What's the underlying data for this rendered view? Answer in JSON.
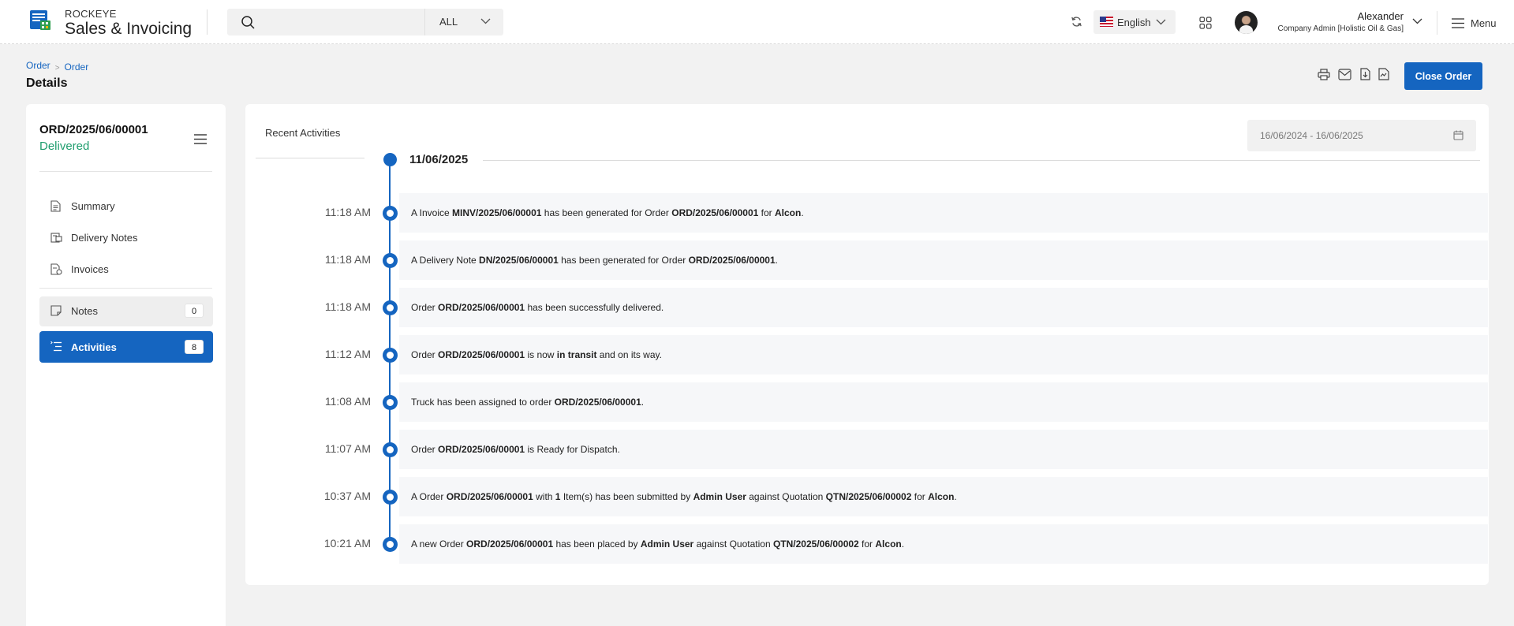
{
  "header": {
    "brand_small": "ROCKEYE",
    "brand_big": "Sales & Invoicing",
    "search_placeholder": "",
    "scope": "ALL",
    "language": "English",
    "user_name": "Alexander",
    "user_role": "Company Admin [Holistic Oil & Gas]",
    "menu_label": "Menu"
  },
  "breadcrumb": {
    "root": "Order",
    "current": "Order",
    "separator": ">"
  },
  "page": {
    "title": "Details",
    "close_order": "Close Order"
  },
  "order": {
    "id": "ORD/2025/06/00001",
    "status": "Delivered"
  },
  "sidebar": {
    "items": [
      {
        "label": "Summary",
        "icon": "document-icon"
      },
      {
        "label": "Delivery Notes",
        "icon": "delivery-note-icon"
      },
      {
        "label": "Invoices",
        "icon": "invoice-icon"
      }
    ],
    "notes": {
      "label": "Notes",
      "count": "0"
    },
    "activities": {
      "label": "Activities",
      "count": "8"
    }
  },
  "activities": {
    "title": "Recent Activities",
    "date_range": "16/06/2024 - 16/06/2025",
    "date": "11/06/2025",
    "entries": [
      {
        "time": "11:18 AM",
        "parts": [
          [
            "A Invoice ",
            false
          ],
          [
            "MINV/2025/06/00001",
            true
          ],
          [
            " has been generated for Order ",
            false
          ],
          [
            "ORD/2025/06/00001",
            true
          ],
          [
            " for ",
            false
          ],
          [
            "Alcon",
            true
          ],
          [
            ".",
            false
          ]
        ]
      },
      {
        "time": "11:18 AM",
        "parts": [
          [
            "A Delivery Note ",
            false
          ],
          [
            "DN/2025/06/00001",
            true
          ],
          [
            " has been generated for Order ",
            false
          ],
          [
            "ORD/2025/06/00001",
            true
          ],
          [
            ".",
            false
          ]
        ]
      },
      {
        "time": "11:18 AM",
        "parts": [
          [
            "Order ",
            false
          ],
          [
            "ORD/2025/06/00001",
            true
          ],
          [
            " has been successfully delivered.",
            false
          ]
        ]
      },
      {
        "time": "11:12 AM",
        "parts": [
          [
            "Order ",
            false
          ],
          [
            "ORD/2025/06/00001",
            true
          ],
          [
            " is now ",
            false
          ],
          [
            "in transit",
            true
          ],
          [
            " and on its way.",
            false
          ]
        ]
      },
      {
        "time": "11:08 AM",
        "parts": [
          [
            "Truck has been assigned to order ",
            false
          ],
          [
            "ORD/2025/06/00001",
            true
          ],
          [
            ".",
            false
          ]
        ]
      },
      {
        "time": "11:07 AM",
        "parts": [
          [
            "Order ",
            false
          ],
          [
            "ORD/2025/06/00001",
            true
          ],
          [
            " is Ready for Dispatch.",
            false
          ]
        ]
      },
      {
        "time": "10:37 AM",
        "parts": [
          [
            "A Order ",
            false
          ],
          [
            "ORD/2025/06/00001",
            true
          ],
          [
            " with ",
            false
          ],
          [
            "1",
            true
          ],
          [
            " Item(s) has been submitted by ",
            false
          ],
          [
            "Admin User",
            true
          ],
          [
            " against Quotation ",
            false
          ],
          [
            "QTN/2025/06/00002",
            true
          ],
          [
            " for ",
            false
          ],
          [
            "Alcon",
            true
          ],
          [
            ".",
            false
          ]
        ]
      },
      {
        "time": "10:21 AM",
        "parts": [
          [
            "A new Order ",
            false
          ],
          [
            "ORD/2025/06/00001",
            true
          ],
          [
            " has been placed by ",
            false
          ],
          [
            "Admin User",
            true
          ],
          [
            " against Quotation ",
            false
          ],
          [
            "QTN/2025/06/00002",
            true
          ],
          [
            " for ",
            false
          ],
          [
            "Alcon",
            true
          ],
          [
            ".",
            false
          ]
        ]
      }
    ]
  },
  "colors": {
    "primary": "#1565c0",
    "status_delivered": "#1f9d6e"
  }
}
